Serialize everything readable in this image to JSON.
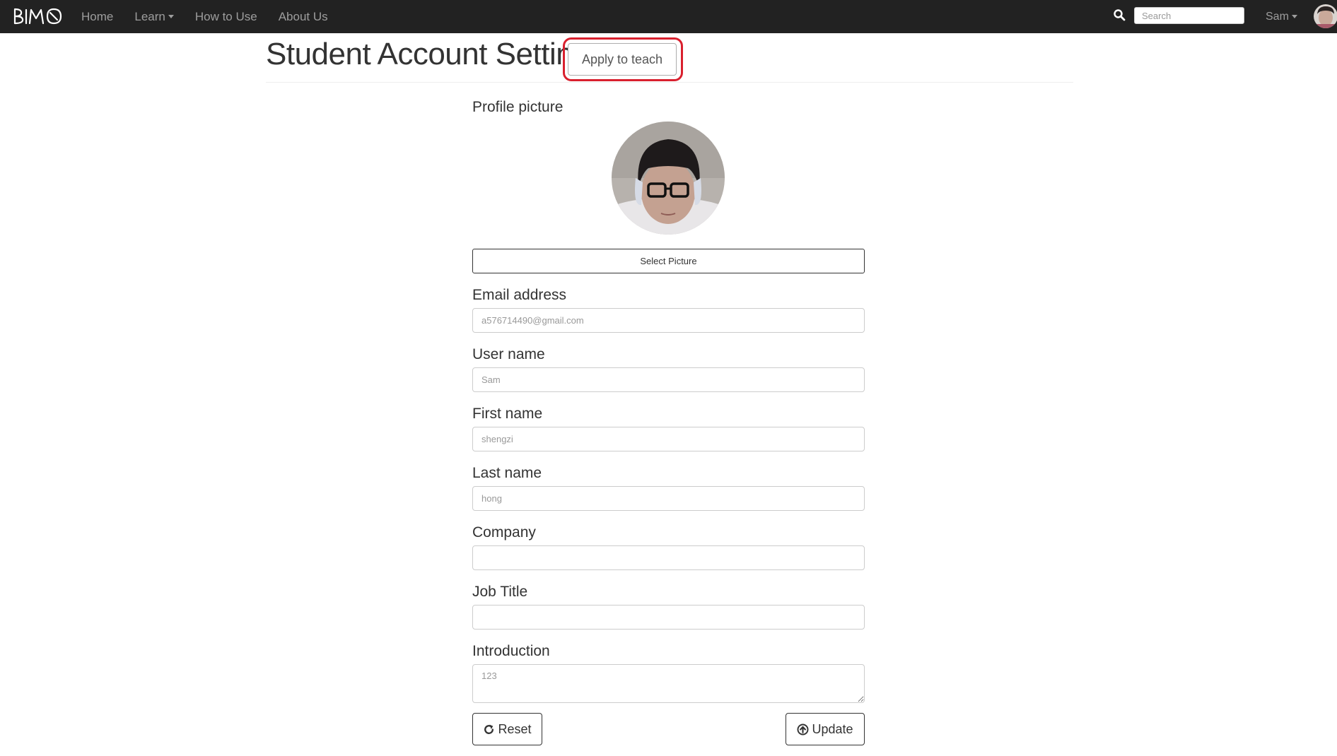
{
  "nav": {
    "brand": "BIMO",
    "links": [
      {
        "label": "Home"
      },
      {
        "label": "Learn"
      },
      {
        "label": "How to Use"
      },
      {
        "label": "About Us"
      }
    ],
    "search_placeholder": "Search",
    "user_label": "Sam"
  },
  "page": {
    "title": "Student Account Setting",
    "apply_button": "Apply to teach"
  },
  "form": {
    "profile_picture_label": "Profile picture",
    "select_picture_button": "Select Picture",
    "email_label": "Email address",
    "email_value": "a576714490@gmail.com",
    "username_label": "User name",
    "username_value": "Sam",
    "firstname_label": "First name",
    "firstname_value": "shengzi",
    "lastname_label": "Last name",
    "lastname_value": "hong",
    "company_label": "Company",
    "company_value": "",
    "jobtitle_label": "Job Title",
    "jobtitle_value": "",
    "introduction_label": "Introduction",
    "introduction_value": "123",
    "reset_button": "Reset",
    "update_button": "Update"
  },
  "colors": {
    "navbar_bg": "#222222",
    "nav_text": "#9d9d9d",
    "highlight": "#d9202e"
  }
}
